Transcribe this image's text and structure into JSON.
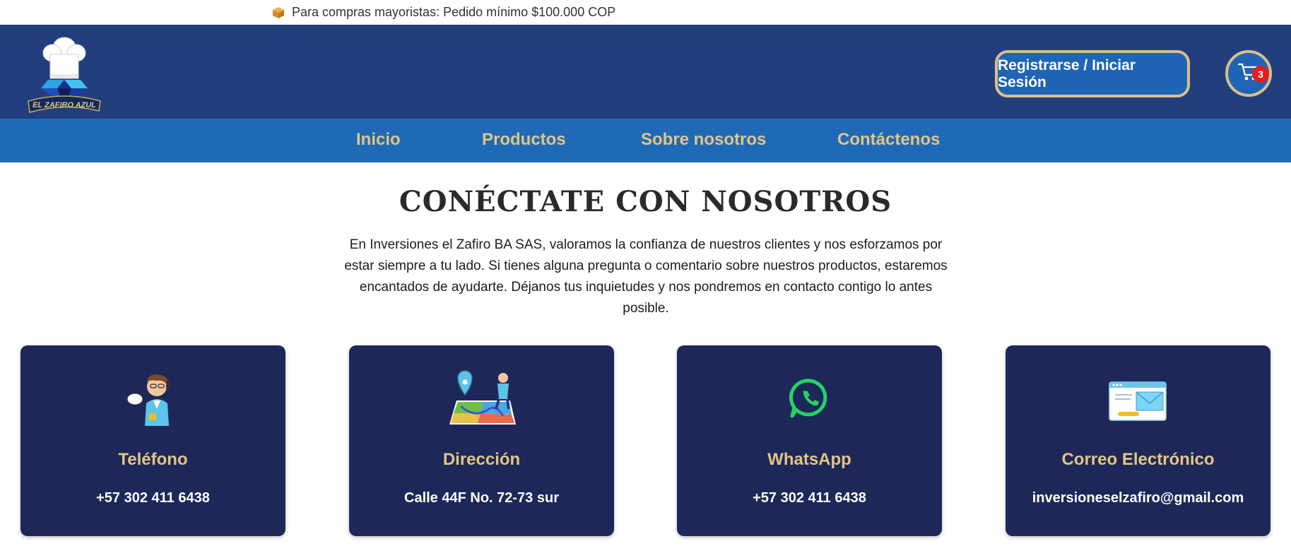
{
  "announcement": {
    "icon": "package-icon",
    "text": "Para compras mayoristas: Pedido mínimo $100.000 COP"
  },
  "header": {
    "logo_text": "EL ZAFIRO AZUL",
    "login_label": "Registrarse / Iniciar Sesión",
    "cart_count": "3"
  },
  "nav": {
    "items": [
      {
        "label": "Inicio"
      },
      {
        "label": "Productos"
      },
      {
        "label": "Sobre nosotros"
      },
      {
        "label": "Contáctenos"
      }
    ]
  },
  "main": {
    "title": "CONÉCTATE CON NOSOTROS",
    "intro": "En Inversiones el Zafiro BA SAS, valoramos la confianza de nuestros clientes y nos esforzamos por estar siempre a tu lado. Si tienes alguna pregunta o comentario sobre nuestros productos, estaremos encantados de ayudarte. Déjanos tus inquietudes y nos pondremos en contacto contigo lo antes posible.",
    "cards": [
      {
        "icon": "phone-person-icon",
        "title": "Teléfono",
        "value": "+57 302 411 6438"
      },
      {
        "icon": "map-location-icon",
        "title": "Dirección",
        "value": "Calle 44F No. 72-73 sur"
      },
      {
        "icon": "whatsapp-icon",
        "title": "WhatsApp",
        "value": "+57 302 411 6438"
      },
      {
        "icon": "email-icon",
        "title": "Correo Electrónico",
        "value": "inversioneselzafiro@gmail.com"
      }
    ]
  },
  "colors": {
    "header_bg": "#233e7c",
    "nav_bg": "#1f6ab7",
    "gold": "#e3c583",
    "card_bg": "#1d2859",
    "badge": "#e51d1d"
  }
}
